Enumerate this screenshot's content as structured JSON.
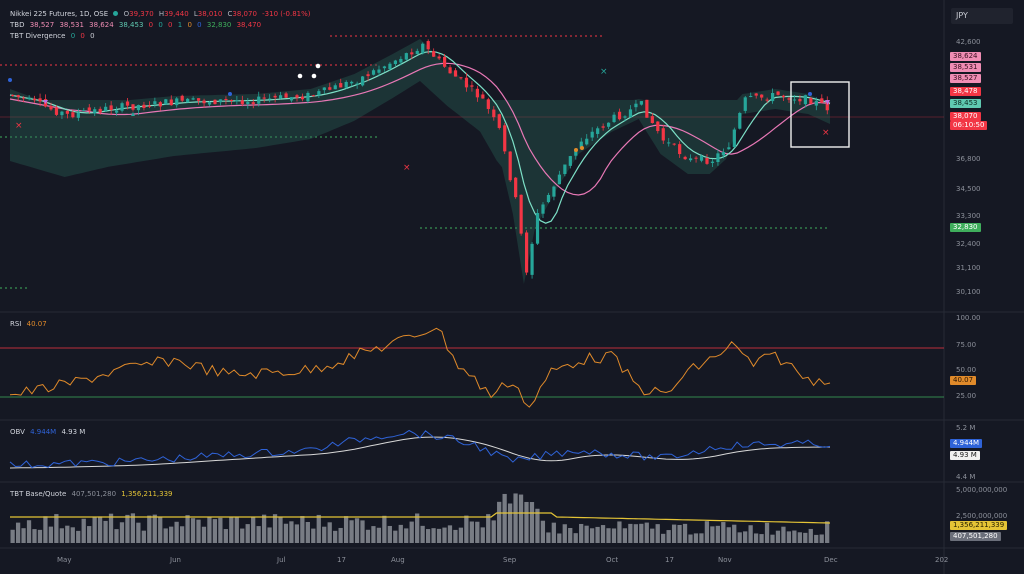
{
  "header": {
    "symbol": "Nikkei 225 Futures, 1D, OSE",
    "open_label": "O",
    "open": "39,370",
    "high_label": "H",
    "high": "39,440",
    "low_label": "L",
    "low": "38,010",
    "close_label": "C",
    "close": "38,070",
    "change": "-310 (-0.81%)"
  },
  "tbd_row": {
    "label": "TBD",
    "values": [
      "38,527",
      "38,531",
      "38,624",
      "38,453",
      "0",
      "0",
      "0",
      "1",
      "0",
      "0",
      "32,830",
      "38,470"
    ]
  },
  "tbt_row": {
    "label": "TBT Divergence",
    "values": [
      "0",
      "0",
      "0"
    ]
  },
  "currency_button": {
    "label": "JPY"
  },
  "price_axis": [
    "42,600",
    "36,800",
    "34,500",
    "33,300",
    "32,400",
    "31,100",
    "30,100"
  ],
  "price_badges": [
    {
      "text": "38,624",
      "color": "#f08db4",
      "fg": "#3a1020"
    },
    {
      "text": "38,531",
      "color": "#f08db4",
      "fg": "#3a1020"
    },
    {
      "text": "38,527",
      "color": "#f08db4",
      "fg": "#3a1020"
    },
    {
      "text": "38,478",
      "color": "#f23645",
      "fg": "#ffffff"
    },
    {
      "text": "38,453",
      "color": "#5fc9b1",
      "fg": "#0c2a22"
    },
    {
      "text": "38,070",
      "color": "#f23645",
      "fg": "#ffffff"
    },
    {
      "text": "06:10:50",
      "color": "#f23645",
      "fg": "#ffffff"
    }
  ],
  "low_badge": {
    "text": "32,830",
    "color": "#3fae5c",
    "fg": "#ffffff"
  },
  "rsi": {
    "label": "RSI",
    "value": "40.07",
    "axis": [
      "100.00",
      "75.00",
      "50.00",
      "25.00"
    ],
    "badge": "40.07"
  },
  "obv": {
    "label": "OBV",
    "value1": "4.944M",
    "value2": "4.93 M",
    "axis": [
      "5.2 M",
      "4.4 M"
    ],
    "badge1": "4.944M",
    "badge2": "4.93 M"
  },
  "volume": {
    "label": "TBT Base/Quote",
    "value1": "407,501,280",
    "value2": "1,356,211,339",
    "axis": [
      "5,000,000,000",
      "2,500,000,000"
    ],
    "badge1": "1,356,211,339",
    "badge2": "407,501,280"
  },
  "time_axis": [
    "May",
    "Jun",
    "Jul",
    "17",
    "Aug",
    "Sep",
    "Oct",
    "17",
    "Nov",
    "Dec",
    "202"
  ],
  "colors": {
    "up": "#26a69a",
    "down": "#f23645",
    "rsi": "#e08a2a",
    "obv": "#2f63d8",
    "obv_ma": "#d8d8d8",
    "vol_ma": "#e4c436",
    "bg": "#151823"
  }
}
